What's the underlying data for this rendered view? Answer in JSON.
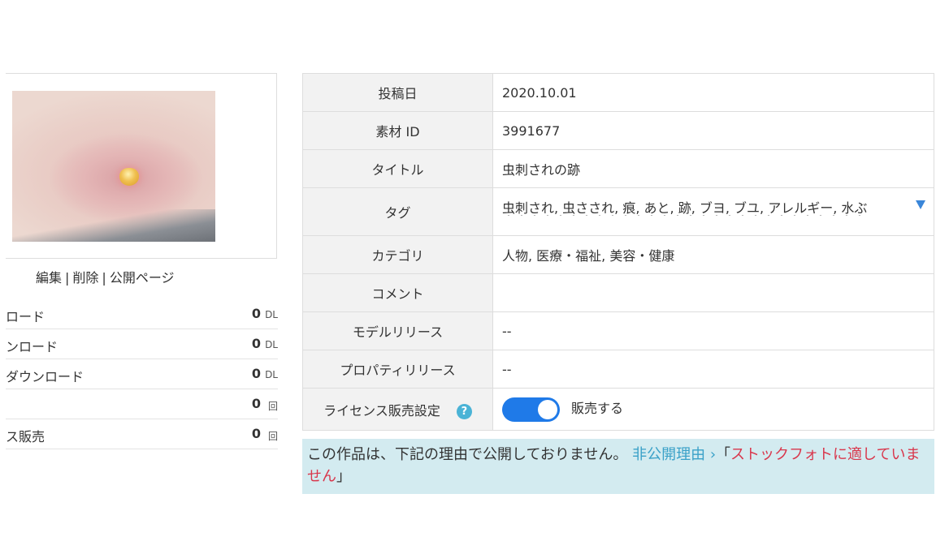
{
  "image": {
    "alt": "虫刺されの跡"
  },
  "actions": {
    "edit": "編集",
    "delete": "削除",
    "public_page": "公開ページ",
    "separator": "|"
  },
  "stats": [
    {
      "label": "ロード",
      "value": "0",
      "unit": "DL"
    },
    {
      "label": "ンロード",
      "value": "0",
      "unit": "DL"
    },
    {
      "label": "ダウンロード",
      "value": "0",
      "unit": "DL"
    },
    {
      "label": "",
      "value": "0",
      "unit": "回"
    },
    {
      "label": "ス販売",
      "value": "0",
      "unit": "回"
    }
  ],
  "details": {
    "posted_date": {
      "label": "投稿日",
      "value": "2020.10.01"
    },
    "material_id": {
      "label": "素材 ID",
      "value": "3991677"
    },
    "title": {
      "label": "タイトル",
      "value": "虫刺されの跡"
    },
    "tags": {
      "label": "タグ",
      "value": "虫刺され, 虫さされ, 痕, あと, 跡, ブヨ, ブユ, アレルギー, 水ぶ",
      "overflow": "・・・・・・・・・・・・・・・・・・・・・・・・・・・・"
    },
    "category": {
      "label": "カテゴリ",
      "value": "人物, 医療・福祉, 美容・健康"
    },
    "comment": {
      "label": "コメント",
      "value": ""
    },
    "model_release": {
      "label": "モデルリリース",
      "value": "--"
    },
    "property_release": {
      "label": "プロパティリリース",
      "value": "--"
    },
    "license": {
      "label": "ライセンス販売設定",
      "help_icon": "?",
      "toggle_on": true,
      "toggle_label": "販売する"
    }
  },
  "notice": {
    "text": "この作品は、下記の理由で公開しておりません。",
    "link": "非公開理由 ›",
    "open_quote": "「",
    "reason": "ストックフォトに適していません",
    "close_quote": "」"
  },
  "colors": {
    "toggle": "#1f7ae8",
    "help": "#4ab3d6",
    "notice_bg": "#d3ebf0",
    "notice_link": "#3aa1c8",
    "notice_reason": "#d9364b"
  }
}
